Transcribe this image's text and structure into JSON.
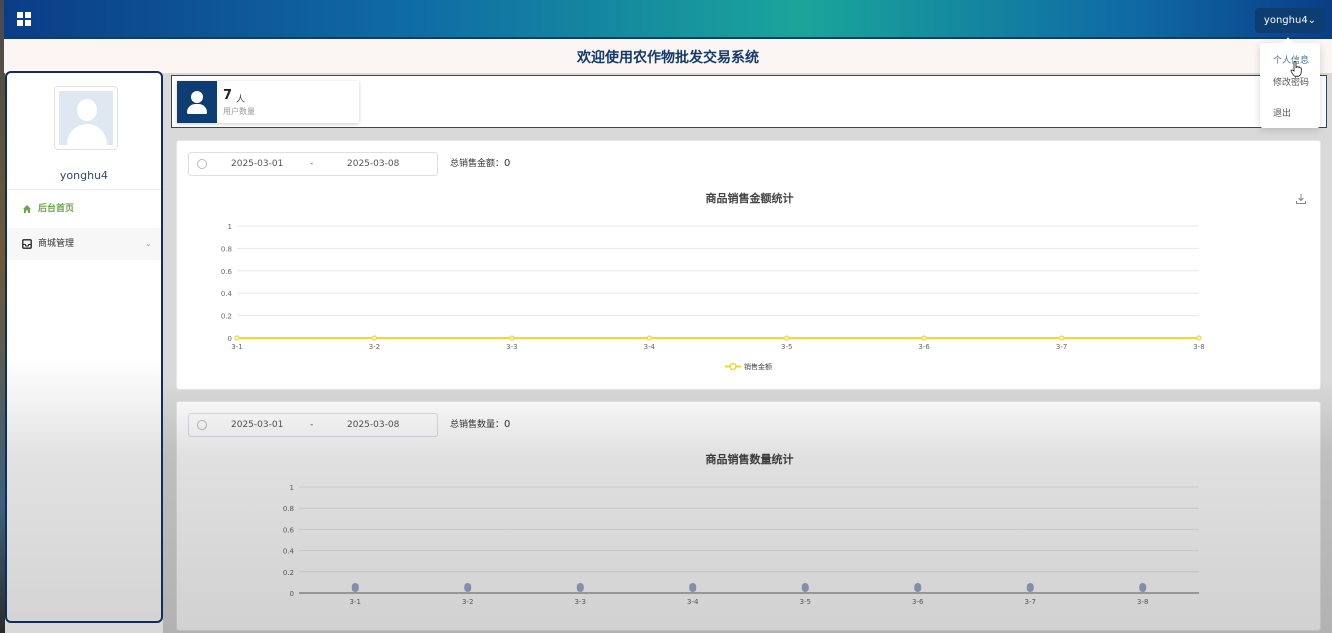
{
  "header": {
    "user_button": "yonghu4⌄",
    "page_title": "欢迎使用农作物批发交易系统"
  },
  "user_dropdown": {
    "items": [
      "个人信息",
      "修改密码",
      "退出"
    ]
  },
  "sidebar": {
    "username": "yonghu4",
    "items": [
      {
        "label": "后台首页",
        "icon": "home-icon",
        "active": true
      },
      {
        "label": "商城管理",
        "icon": "inbox-icon",
        "active": false
      }
    ]
  },
  "stats": {
    "user_count": "7",
    "user_unit": "人",
    "user_label": "用户数量"
  },
  "sales_amount": {
    "start_date": "2025-03-01",
    "separator": "-",
    "end_date": "2025-03-08",
    "total_label": "总销售金额：",
    "total_value": "0",
    "title": "商品销售金额统计"
  },
  "sales_quantity": {
    "start_date": "2025-03-01",
    "separator": "-",
    "end_date": "2025-03-08",
    "total_label": "总销售数量：",
    "total_value": "0",
    "title": "商品销售数量统计"
  },
  "colors": {
    "accent": "#0d3d73",
    "line_series": "#f5d62a",
    "bar_marker": "#7a8fb5",
    "active_menu": "#6aa84f"
  },
  "chart_data": [
    {
      "type": "line",
      "title": "商品销售金额统计",
      "x": [
        "3-1",
        "3-2",
        "3-3",
        "3-4",
        "3-5",
        "3-6",
        "3-7",
        "3-8"
      ],
      "series": [
        {
          "name": "销售金额",
          "values": [
            0,
            0,
            0,
            0,
            0,
            0,
            0,
            0
          ]
        }
      ],
      "ylim": [
        0,
        1
      ],
      "yticks": [
        "0",
        "0.2",
        "0.4",
        "0.6",
        "0.8",
        "1"
      ],
      "grid": true,
      "legend": "bottom"
    },
    {
      "type": "bar",
      "title": "商品销售数量统计",
      "categories": [
        "3-1",
        "3-2",
        "3-3",
        "3-4",
        "3-5",
        "3-6",
        "3-7",
        "3-8"
      ],
      "series": [
        {
          "values": [
            0,
            0,
            0,
            0,
            0,
            0,
            0,
            0
          ]
        }
      ],
      "ylim": [
        0,
        1
      ],
      "yticks": [
        "0",
        "0.2",
        "0.4",
        "0.6",
        "0.8",
        "1"
      ],
      "grid": true
    }
  ]
}
